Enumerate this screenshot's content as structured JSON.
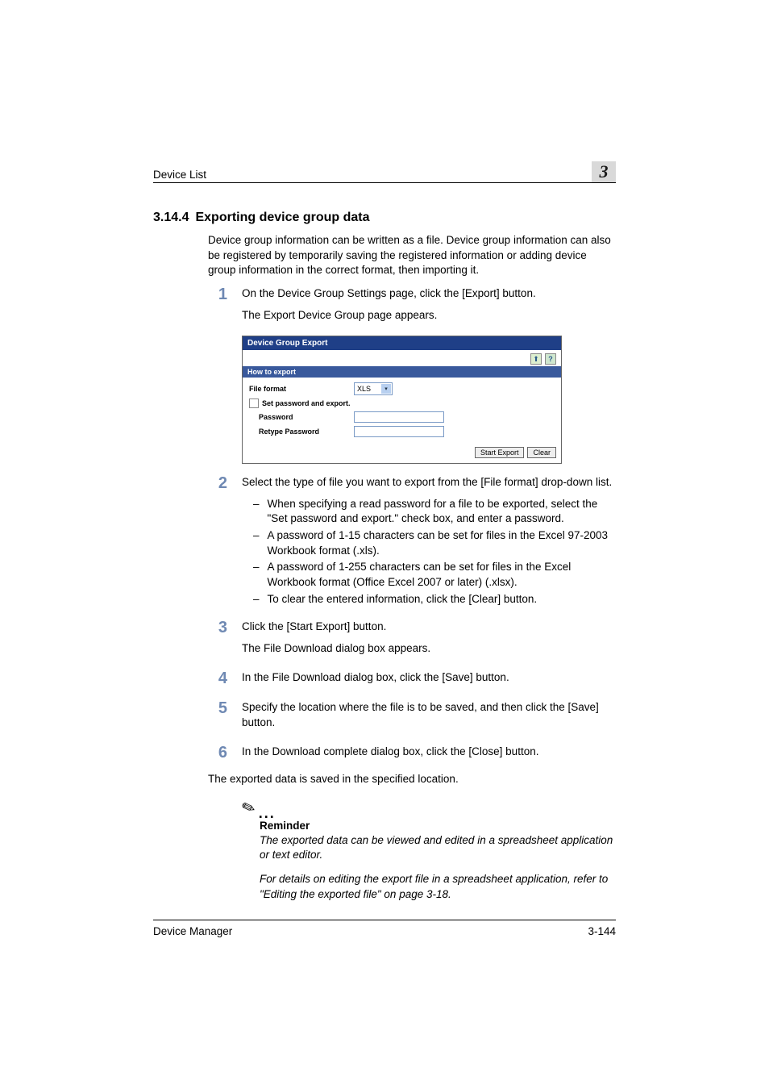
{
  "header": {
    "left": "Device List",
    "chapter": "3"
  },
  "section": {
    "num": "3.14.4",
    "title": "Exporting device group data"
  },
  "intro": "Device group information can be written as a file. Device group information can also be registered by temporarily saving the registered information or adding device group information in the correct format, then importing it.",
  "steps": [
    {
      "n": "1",
      "lines": [
        "On the Device Group Settings page, click the [Export] button.",
        "The Export Device Group page appears."
      ]
    },
    {
      "n": "2",
      "lines": [
        "Select the type of file you want to export from the [File format] drop-down list."
      ],
      "subs": [
        "When specifying a read password for a file to be exported, select the \"Set password and export.\" check box, and enter a password.",
        "A password of 1-15 characters can be set for files in the Excel 97-2003 Workbook format (.xls).",
        "A password of 1-255 characters can be set for files in the Excel Workbook format (Office Excel 2007 or later) (.xlsx).",
        "To clear the entered information, click the [Clear] button."
      ]
    },
    {
      "n": "3",
      "lines": [
        "Click the [Start Export] button.",
        "The File Download dialog box appears."
      ]
    },
    {
      "n": "4",
      "lines": [
        "In the File Download dialog box, click the [Save] button."
      ]
    },
    {
      "n": "5",
      "lines": [
        "Specify the location where the file is to be saved, and then click the [Save] button."
      ]
    },
    {
      "n": "6",
      "lines": [
        "In the Download complete dialog box, click the [Close] button."
      ]
    }
  ],
  "closing": "The exported data is saved in the specified location.",
  "reminder": {
    "head": "Reminder",
    "texts": [
      "The exported data can be viewed and edited in a spreadsheet application or text editor.",
      "For details on editing the export file in a spreadsheet application, refer to \"Editing the exported file\" on page 3-18."
    ]
  },
  "screenshot": {
    "title": "Device Group Export",
    "section": "How to export",
    "labels": {
      "file_format": "File format",
      "set_password": "Set password and export.",
      "password": "Password",
      "retype": "Retype Password"
    },
    "select_value": "XLS",
    "buttons": {
      "start": "Start Export",
      "clear": "Clear"
    },
    "help_glyph": "?",
    "up_glyph": "⬆"
  },
  "footer": {
    "left": "Device Manager",
    "right": "3-144"
  }
}
